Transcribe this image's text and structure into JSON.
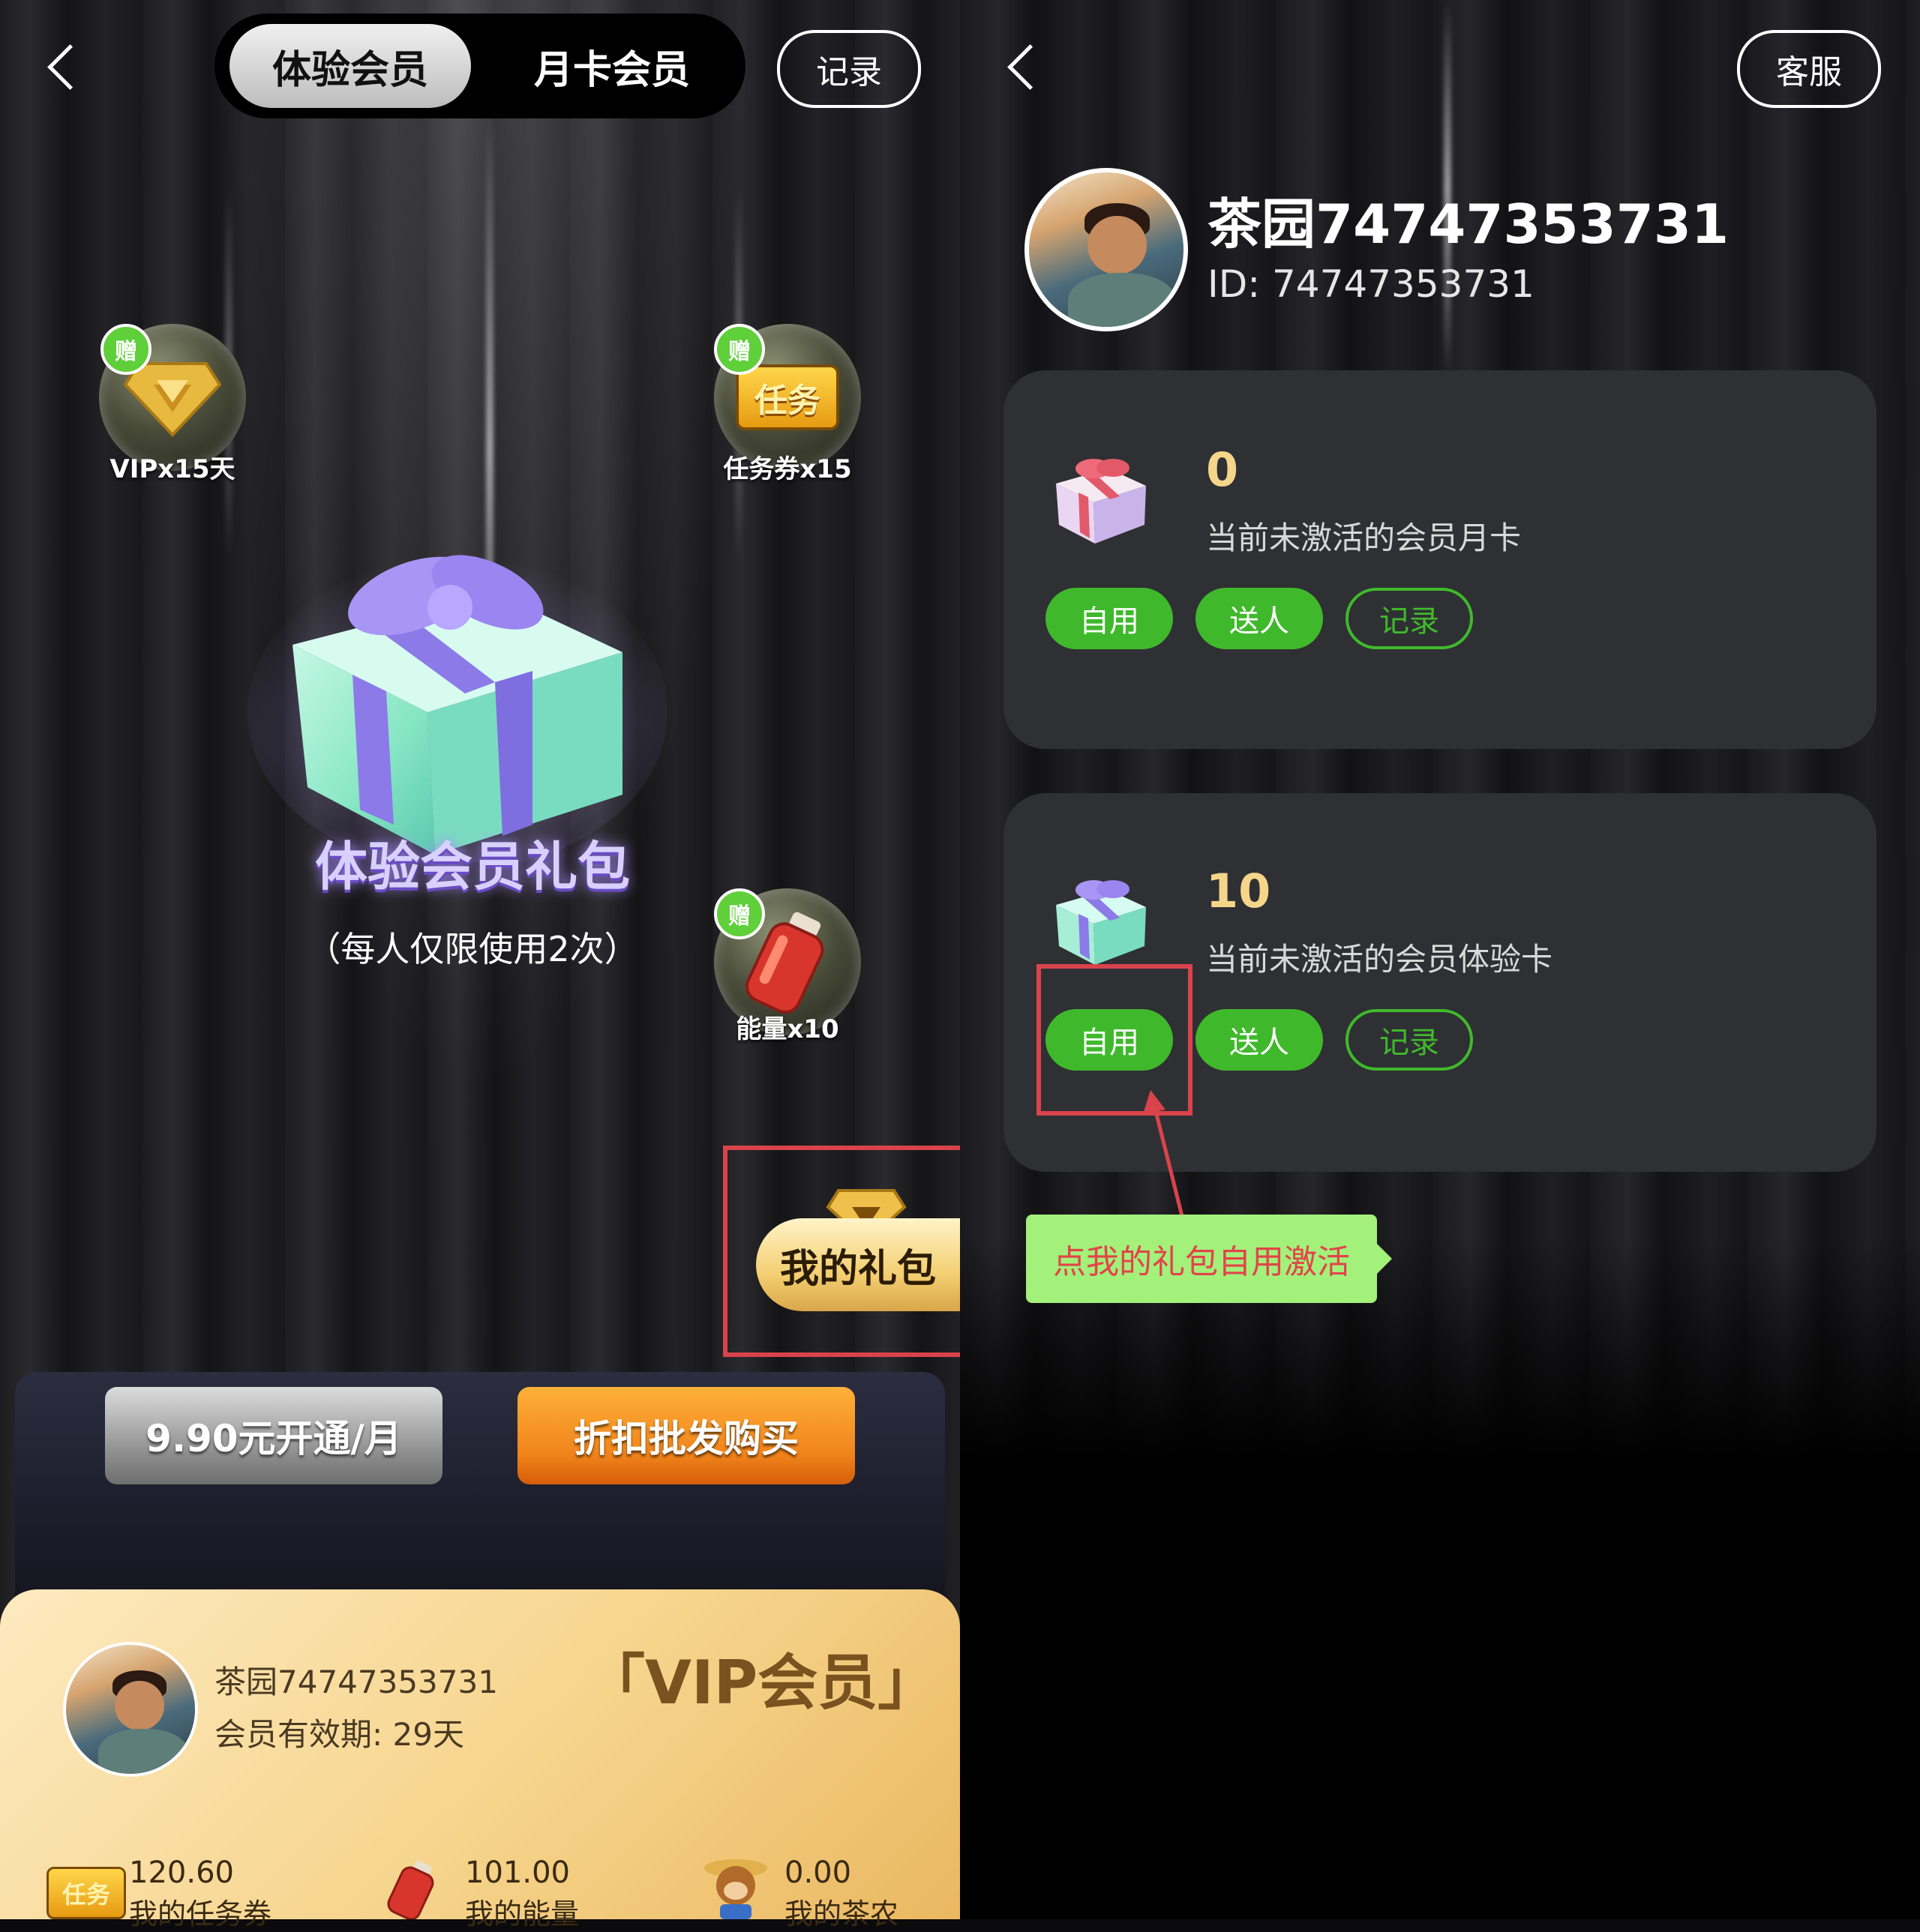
{
  "left": {
    "tabs": [
      "体验会员",
      "月卡会员"
    ],
    "record_button": "记录",
    "rewards": [
      {
        "badge": "赠",
        "label": "VIPx15天",
        "icon": "vip-diamond-icon"
      },
      {
        "badge": "赠",
        "label": "任务券x15",
        "icon": "task-ticket-icon",
        "icon_text": "任务"
      },
      {
        "badge": "赠",
        "label": "能量x10",
        "icon": "energy-bottle-icon"
      }
    ],
    "gift_title": "体验会员礼包",
    "gift_subtitle": "（每人仅限使用2次）",
    "my_gift_button": "我的礼包",
    "buy_monthly": "9.90元开通/月",
    "buy_wholesale": "折扣批发购买",
    "vip_card": {
      "name": "茶园74747353731",
      "validity": "会员有效期: 29天",
      "vip_label": "「VIP会员」",
      "stats": [
        {
          "value": "120.60",
          "label": "我的任务券",
          "icon": "task-ticket-icon"
        },
        {
          "value": "101.00",
          "label": "我的能量",
          "icon": "energy-bottle-icon"
        },
        {
          "value": "0.00",
          "label": "我的茶农",
          "icon": "monkey-farmer-icon"
        }
      ]
    }
  },
  "right": {
    "service_button": "客服",
    "profile": {
      "name": "茶园74747353731",
      "id_text": "ID: 74747353731"
    },
    "cards": [
      {
        "count": "0",
        "desc": "当前未激活的会员月卡",
        "buttons": [
          "自用",
          "送人",
          "记录"
        ]
      },
      {
        "count": "10",
        "desc": "当前未激活的会员体验卡",
        "buttons": [
          "自用",
          "送人",
          "记录"
        ]
      }
    ],
    "tooltip": "点我的礼包自用激活"
  },
  "colors": {
    "accent_green": "#3fb92b",
    "highlight_red": "#d9434b",
    "gold_count": "#f5d58a",
    "tooltip_bg": "#a3f07a"
  }
}
